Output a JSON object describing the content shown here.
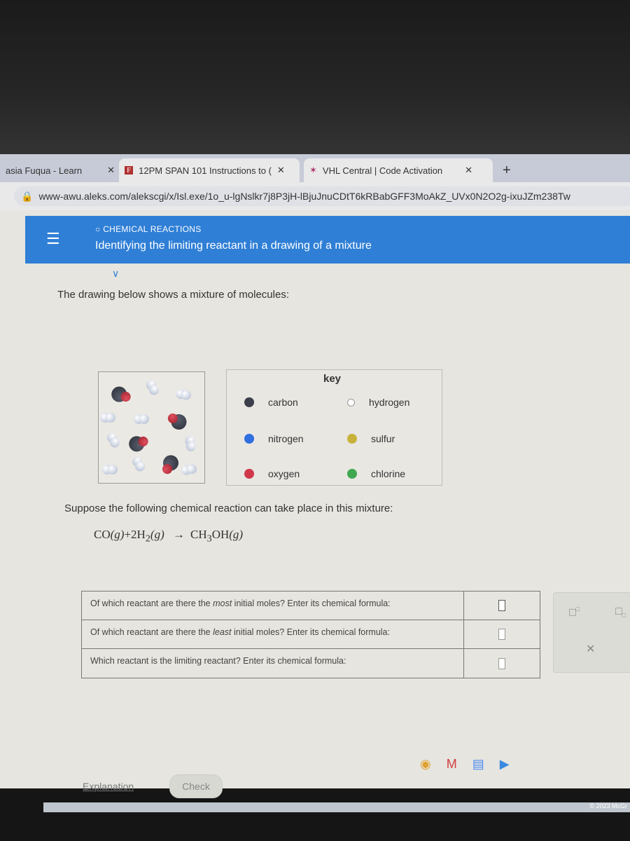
{
  "browser": {
    "tabs": [
      {
        "label": "asia Fuqua - Learn",
        "icon": "learn"
      },
      {
        "label": "12PM SPAN 101 Instructions to (",
        "icon": "F-logo"
      },
      {
        "label": "VHL Central | Code Activation",
        "icon": "vhl-logo"
      }
    ],
    "new_tab": "+",
    "url": "www-awu.aleks.com/alekscgi/x/Isl.exe/1o_u-lgNslkr7j8P3jH-lBjuJnuCDtT6kRBabGFF3MoAkZ_UVx0N2O2g-ixuJZm238Tw"
  },
  "header": {
    "topic": "CHEMICAL REACTIONS",
    "title": "Identifying the limiting reactant in a drawing of a mixture",
    "accent": "#2f7fd6"
  },
  "problem": {
    "prompt": "The drawing below shows a mixture of molecules:",
    "key_title": "key",
    "key": [
      {
        "label": "carbon",
        "color": "#3b3f4a"
      },
      {
        "label": "hydrogen",
        "color": "#ffffff"
      },
      {
        "label": "nitrogen",
        "color": "#2f6fe0"
      },
      {
        "label": "sulfur",
        "color": "#c9b23a"
      },
      {
        "label": "oxygen",
        "color": "#d0384a"
      },
      {
        "label": "chlorine",
        "color": "#3fa84f"
      }
    ],
    "suppose": "Suppose the following chemical reaction can take place in this mixture:",
    "equation": {
      "r1": "CO",
      "s1": "(g)",
      "plus": "+2",
      "r2": "H",
      "r2sub": "2",
      "s2": "(g)",
      "arrow": "→",
      "p1": "CH",
      "p1sub": "3",
      "p1b": "OH",
      "s3": "(g)"
    }
  },
  "questions": [
    {
      "pre": "Of which reactant are there the ",
      "em": "most",
      "post": " initial moles? Enter its chemical formula:",
      "value": ""
    },
    {
      "pre": "Of which reactant are there the ",
      "em": "least",
      "post": " initial moles? Enter its chemical formula:",
      "value": ""
    },
    {
      "pre": "Which reactant is the limiting reactant? Enter its chemical formula:",
      "em": "",
      "post": "",
      "value": ""
    }
  ],
  "buttons": {
    "explanation": "Explanation",
    "check": "Check"
  },
  "footer": "© 2023 McGr"
}
